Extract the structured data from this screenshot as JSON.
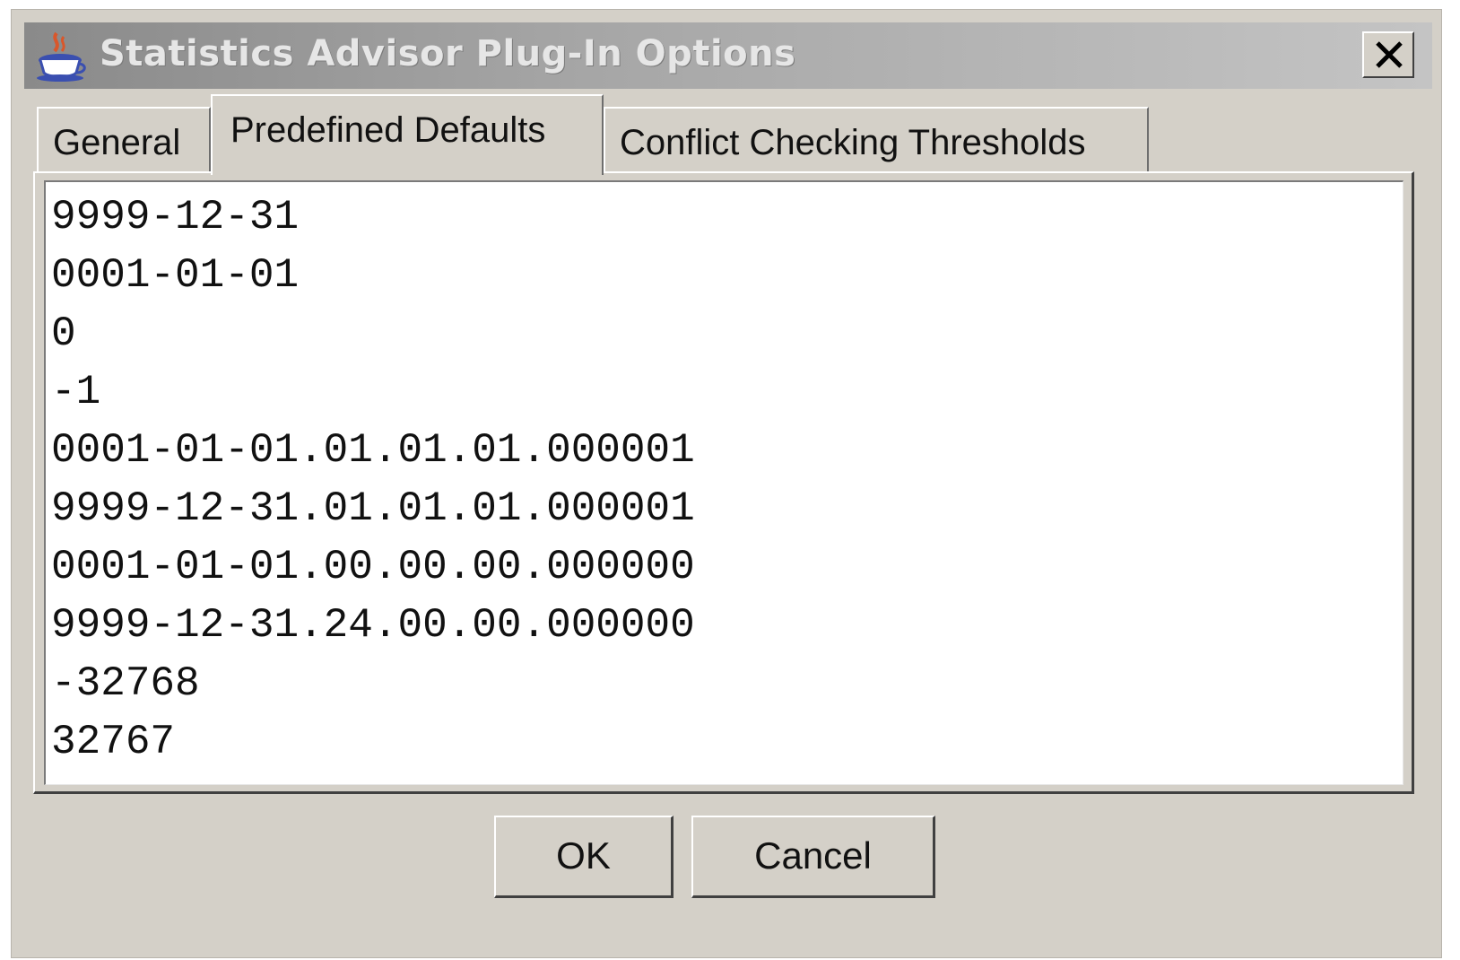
{
  "window": {
    "title": "Statistics Advisor Plug-In Options",
    "icon": "java-coffee-cup-icon",
    "close_icon": "close-icon"
  },
  "tabs": [
    {
      "label": "General",
      "selected": false
    },
    {
      "label": "Predefined Defaults",
      "selected": true
    },
    {
      "label": "Conflict Checking Thresholds",
      "selected": false
    }
  ],
  "defaults_text": {
    "lines": [
      "9999-12-31",
      "0001-01-01",
      "0",
      "-1",
      "0001-01-01.01.01.01.000001",
      "9999-12-31.01.01.01.000001",
      "0001-01-01.00.00.00.000000",
      "9999-12-31.24.00.00.000000",
      "-32768",
      "32767"
    ]
  },
  "buttons": {
    "ok_label": "OK",
    "cancel_label": "Cancel"
  },
  "colors": {
    "dialog_background": "#d4d0c8",
    "titlebar_start": "#8a8a8a",
    "titlebar_end": "#c4c4c4",
    "text_area_background": "#ffffff"
  }
}
